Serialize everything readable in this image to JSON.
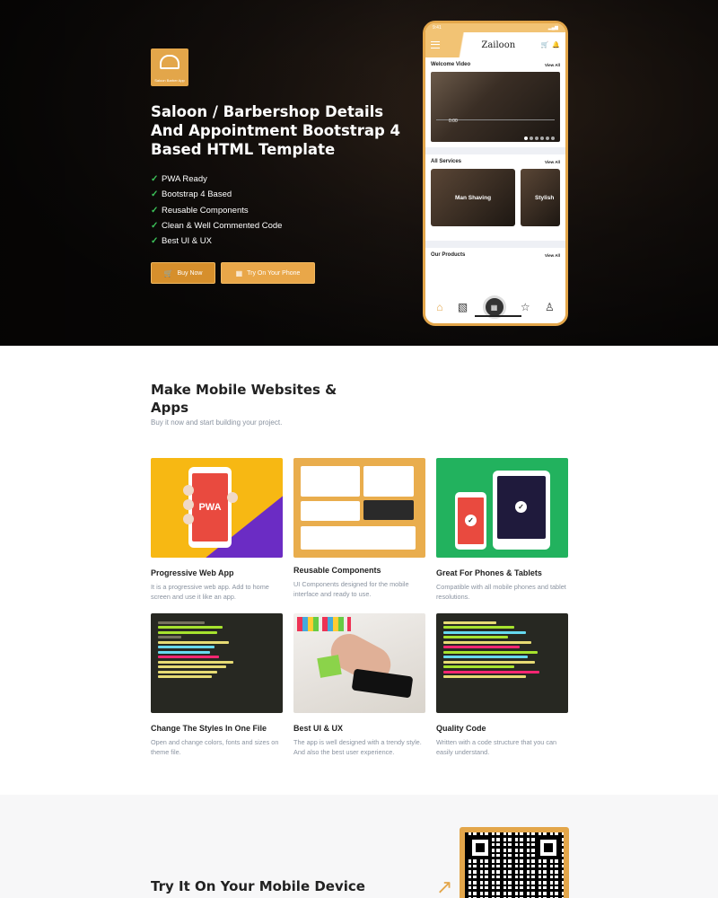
{
  "hero": {
    "logo_text": "Saloon Barber App",
    "title": "Saloon / Barbershop Details And Appointment Bootstrap 4 Based HTML Template",
    "features": [
      "PWA Ready",
      "Bootstrap 4 Based",
      "Reusable Components",
      "Clean & Well Commented Code",
      "Best UI & UX"
    ],
    "buy_label": "Buy Now",
    "try_label": "Try On Your Phone"
  },
  "phone": {
    "time": "9:41",
    "brand": "Zailoon",
    "welcome_title": "Welcome Video",
    "view_all": "View All",
    "video_time": "0:00",
    "services_title": "All Services",
    "service_1": "Man Shaving",
    "service_2": "Stylish",
    "products_title": "Our Products"
  },
  "section2": {
    "title": "Make Mobile Websites & Apps",
    "subtitle": "Buy it now and start building your project.",
    "tiles": [
      {
        "title": "Progressive Web App",
        "desc": "It is a progressive web app. Add to home screen and use it like an app."
      },
      {
        "title": "Reusable Components",
        "desc": "UI Components designed for the mobile interface and ready to use."
      },
      {
        "title": "Great For Phones & Tablets",
        "desc": "Compatible with all mobile phones and tablet resolutions."
      },
      {
        "title": "Change The Styles In One File",
        "desc": "Open and change colors, fonts and sizes on theme file."
      },
      {
        "title": "Best UI & UX",
        "desc": "The app is well designed with a trendy style. And also the best user experience."
      },
      {
        "title": "Quality Code",
        "desc": "Written with a code structure that you can easily understand."
      }
    ],
    "pwa_label": "PWA"
  },
  "section3": {
    "title": "Try It On Your Mobile Device"
  },
  "colors": {
    "accent": "#e3a64a",
    "check": "#3cc35a",
    "pwa_bg": "#f7b813",
    "phones_bg": "#22b25e"
  }
}
